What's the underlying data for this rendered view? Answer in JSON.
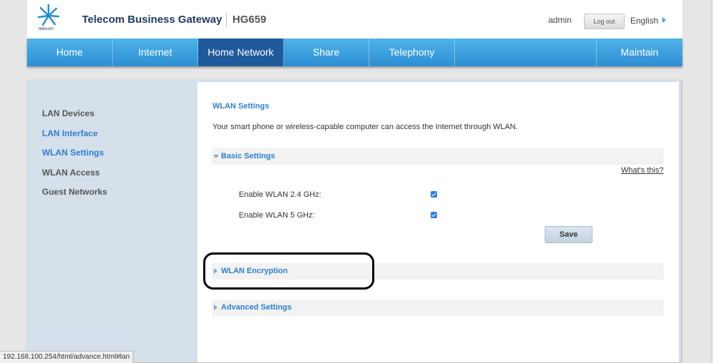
{
  "header": {
    "logo_text": "telecom",
    "title": "Telecom Business Gateway",
    "model": "HG659",
    "user": "admin",
    "logout_label": "Log out",
    "language": "English"
  },
  "nav": {
    "items": [
      {
        "label": "Home"
      },
      {
        "label": "Internet"
      },
      {
        "label": "Home Network"
      },
      {
        "label": "Share"
      },
      {
        "label": "Telephony"
      },
      {
        "label": "Maintain"
      }
    ],
    "active": "Home Network"
  },
  "sidebar": {
    "items": [
      {
        "label": "LAN Devices"
      },
      {
        "label": "LAN Interface"
      },
      {
        "label": "WLAN Settings"
      },
      {
        "label": "WLAN Access"
      },
      {
        "label": "Guest Networks"
      }
    ]
  },
  "content": {
    "title": "WLAN Settings",
    "description": "Your smart phone or wireless-capable computer can access the Internet through WLAN.",
    "basic": {
      "label": "Basic Settings",
      "help": "What's this?",
      "rows": [
        {
          "label": "Enable WLAN 2.4 GHz:",
          "checked": true
        },
        {
          "label": "Enable WLAN 5 GHz:",
          "checked": true
        }
      ],
      "save_label": "Save"
    },
    "encryption_label": "WLAN Encryption",
    "advanced_label": "Advanced Settings"
  },
  "status_bar": "192.168.100.254/html/advance.html#lan",
  "colors": {
    "nav_blue": "#3aa0e0",
    "nav_active": "#1f5a9c",
    "link_blue": "#2b7fd3",
    "sidebar_bg": "#d6e0ea"
  }
}
